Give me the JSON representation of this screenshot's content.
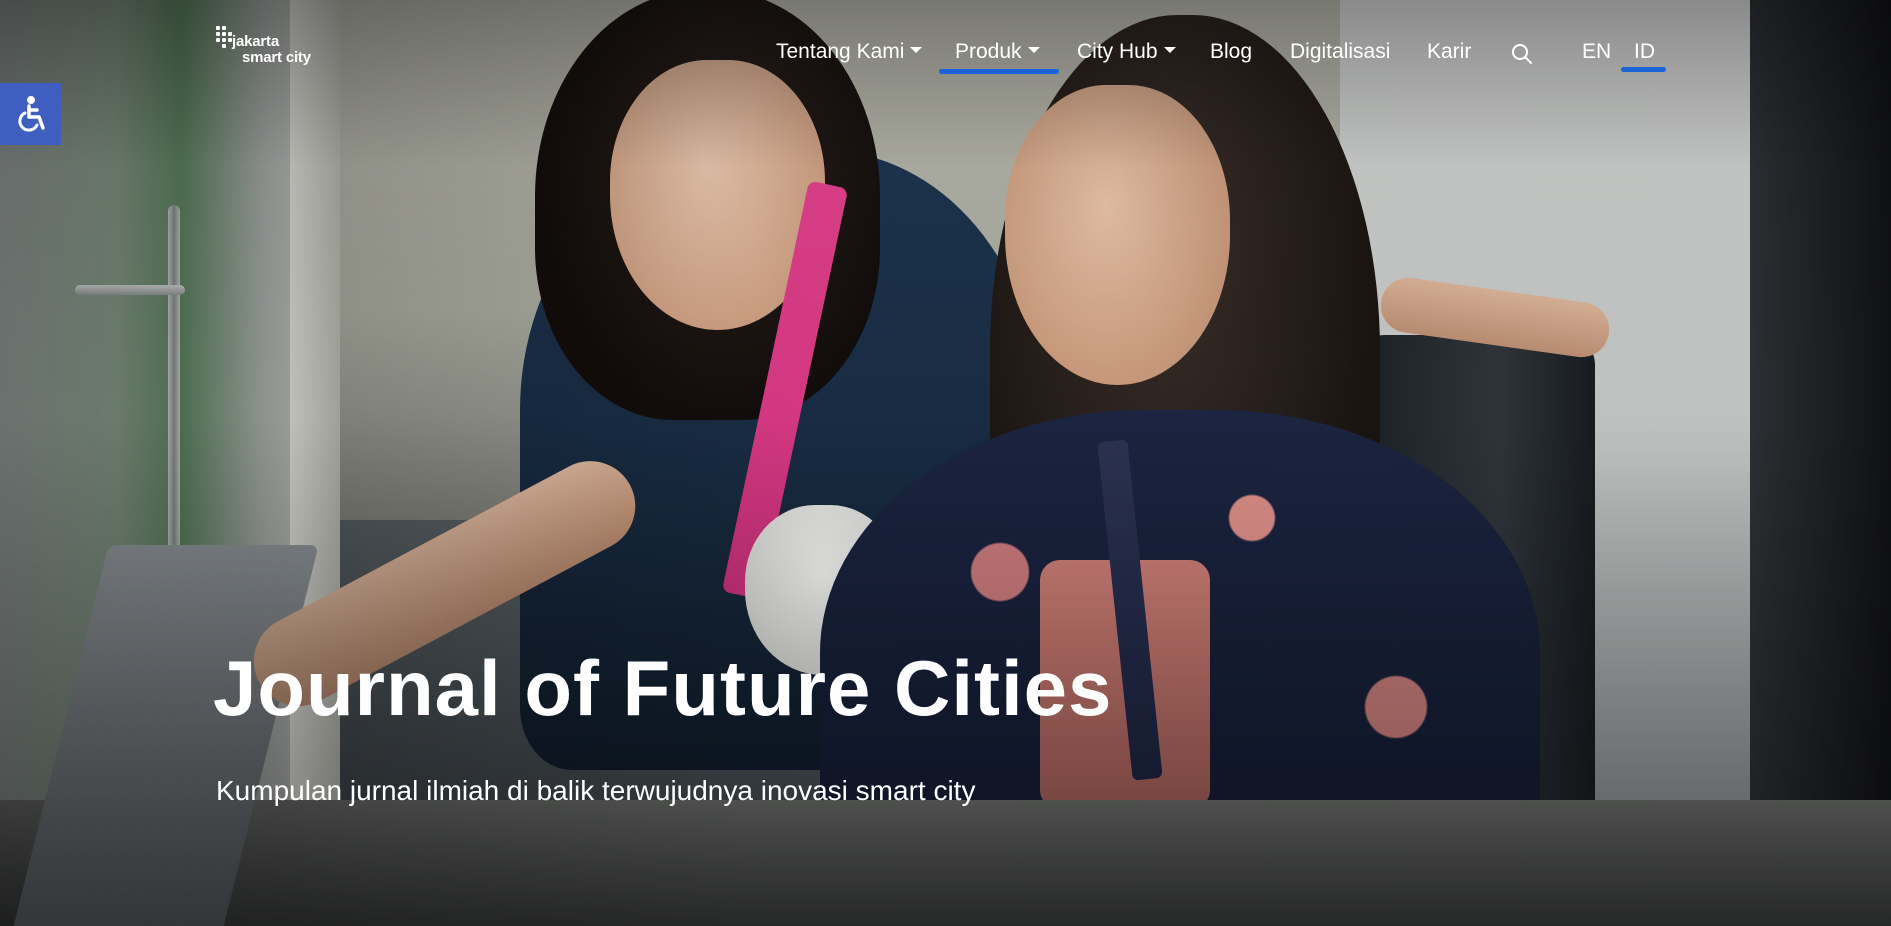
{
  "brand": {
    "logo_line1": "jakarta",
    "logo_line2": "smart city"
  },
  "nav": {
    "items": [
      {
        "label": "Tentang Kami",
        "dropdown": true,
        "active": false
      },
      {
        "label": "Produk",
        "dropdown": true,
        "active": true
      },
      {
        "label": "City Hub",
        "dropdown": true,
        "active": false
      },
      {
        "label": "Blog",
        "dropdown": false,
        "active": false
      },
      {
        "label": "Digitalisasi",
        "dropdown": false,
        "active": false
      },
      {
        "label": "Karir",
        "dropdown": false,
        "active": false
      }
    ],
    "search_icon": "search-icon",
    "languages": [
      {
        "label": "EN",
        "active": false
      },
      {
        "label": "ID",
        "active": true
      }
    ]
  },
  "accessibility": {
    "icon": "wheelchair-icon",
    "color": "#3f5fc0"
  },
  "hero": {
    "title": "Journal of Future Cities",
    "subtitle": "Kumpulan jurnal ilmiah di balik terwujudnya inovasi smart city"
  },
  "colors": {
    "accent": "#1b63d8",
    "text": "#ffffff"
  }
}
